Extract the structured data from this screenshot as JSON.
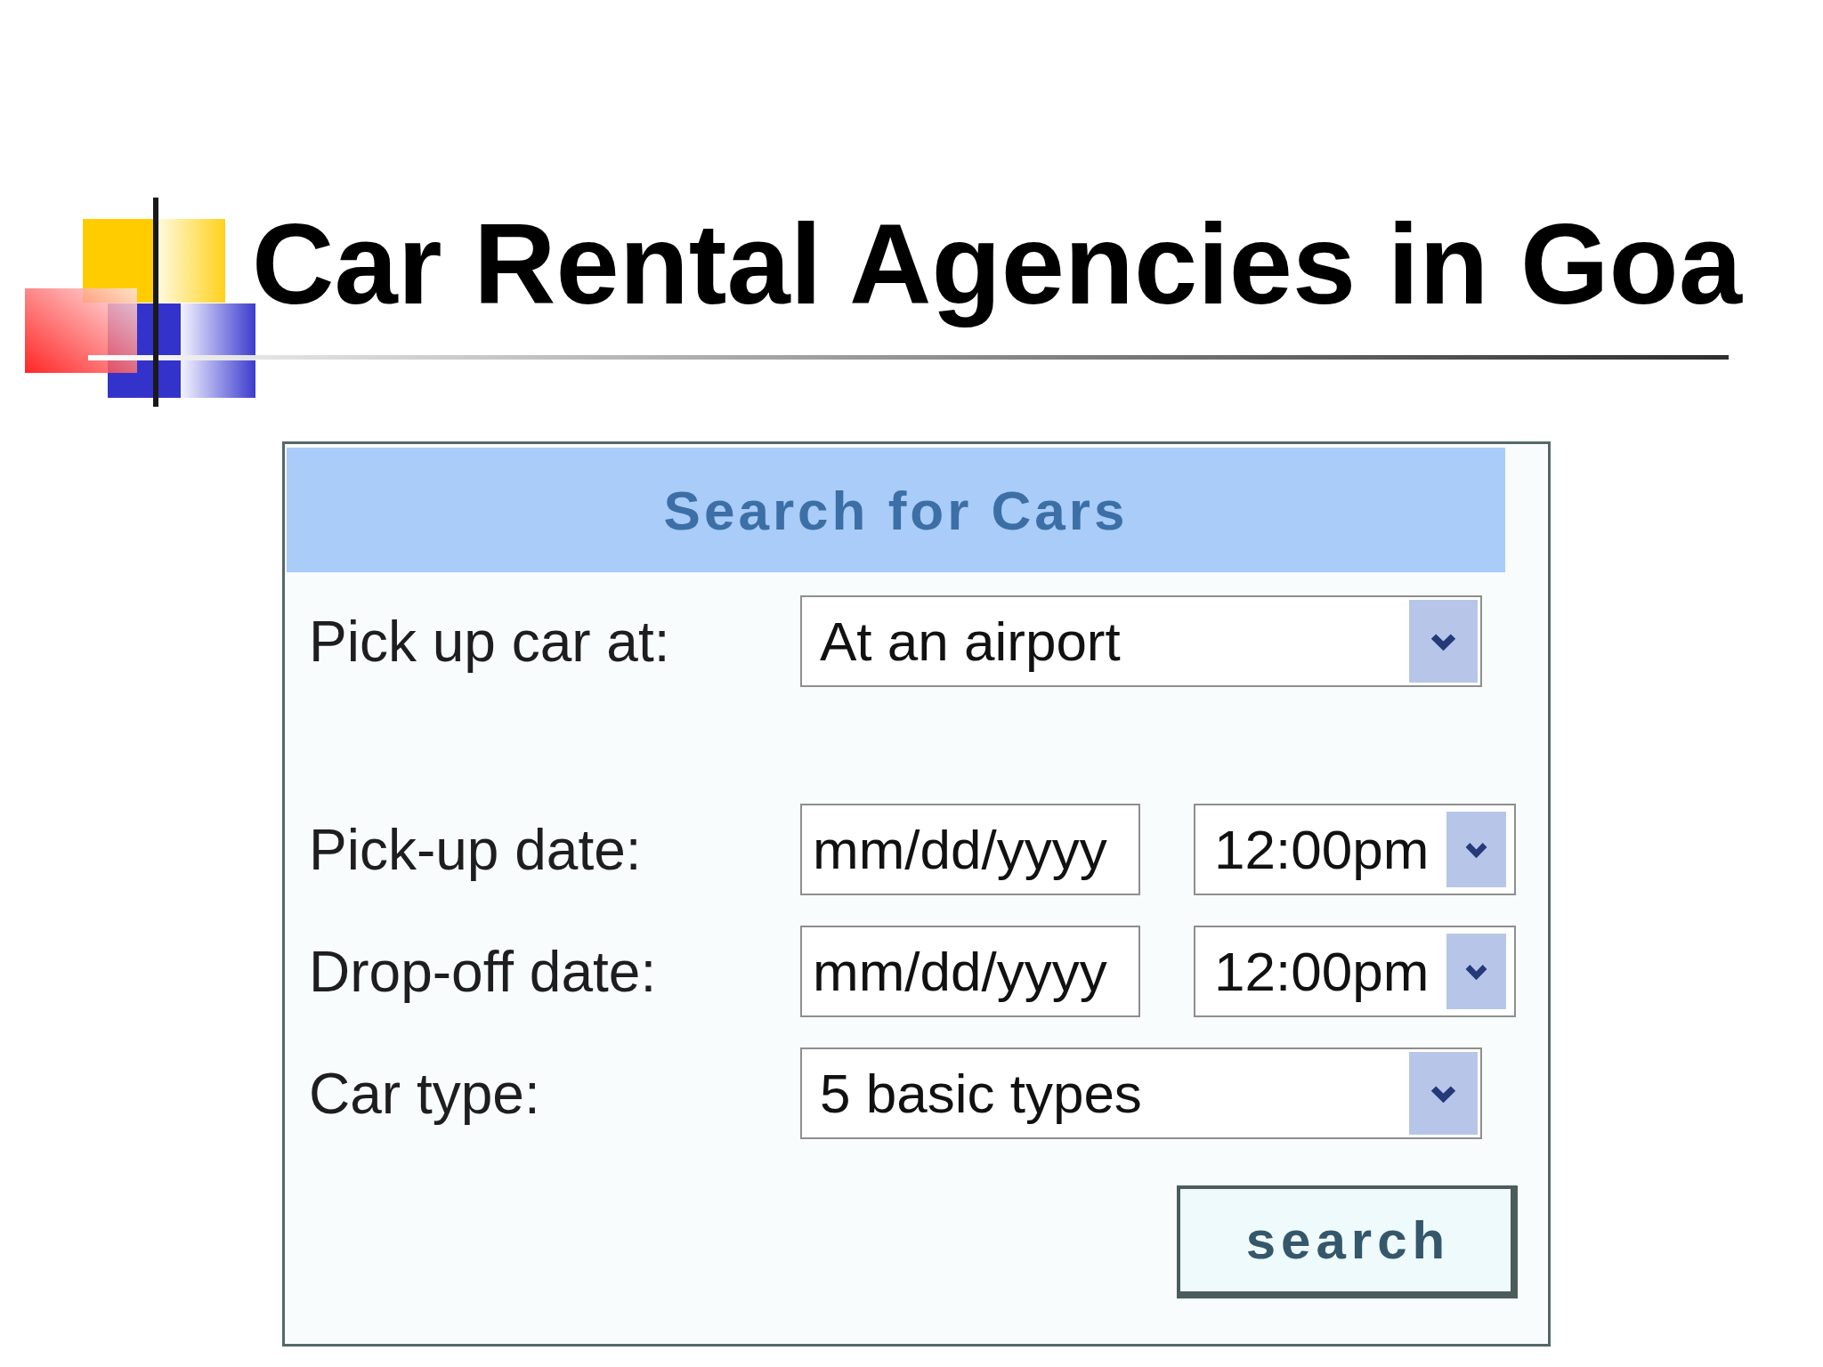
{
  "slide": {
    "title": "Car Rental Agencies in Goa"
  },
  "search_form": {
    "title": "Search for Cars",
    "fields": [
      {
        "kind": "select",
        "label": "Pick up car at:",
        "value": "At an airport"
      },
      {
        "kind": "date_time",
        "label": "Pick-up date:",
        "placeholder": "mm/dd/yyyy",
        "time": "12:00pm"
      },
      {
        "kind": "date_time",
        "label": "Drop-off date:",
        "placeholder": "mm/dd/yyyy",
        "time": "12:00pm"
      },
      {
        "kind": "select",
        "label": "Car type:",
        "value": "5 basic types"
      }
    ],
    "button": "search"
  }
}
